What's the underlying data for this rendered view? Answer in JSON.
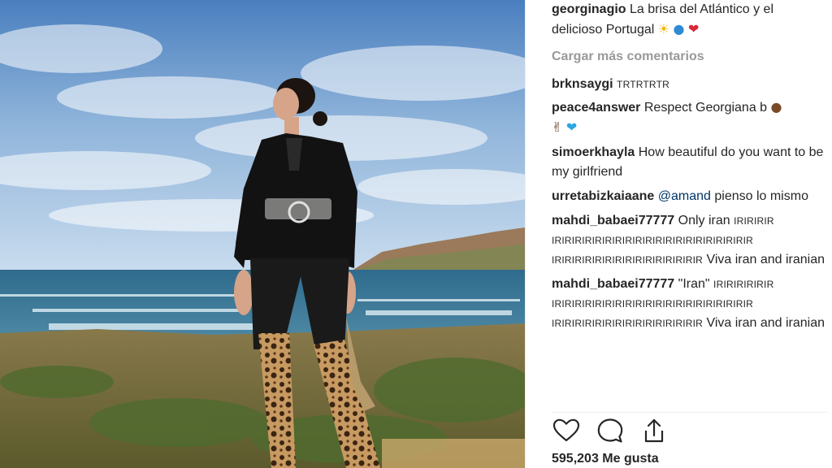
{
  "post": {
    "caption": {
      "user": "georginagio",
      "text": "La brisa del Atlántico y el delicioso Portugal"
    },
    "caption_emojis": [
      "sun-emoji",
      "globe-emoji",
      "heart-emoji"
    ],
    "load_more_label": "Cargar más comentarios",
    "comments": [
      {
        "user": "brknsaygi",
        "text": "TRTRTRTR"
      },
      {
        "user": "peace4answer",
        "text": "Respect Georgiana b"
      },
      {
        "user": "simoerkhayla",
        "text": "How beautiful do you want to be my girlfriend"
      },
      {
        "user": "urretabizkaiaane",
        "mention": "@amand",
        "text": "pienso lo mismo"
      },
      {
        "user": "mahdi_babaei77777",
        "text_a": "Only iran",
        "text_b": "IRIRIRIR",
        "text_c": "IRIRIRIRIRIRIRIRIRIRIRIRIRIRIRIRIRIRIRIR",
        "text_d": "IRIRIRIRIRIRIRIRIRIRIRIRIRIRIR",
        "text_e": "Viva iran and iranian"
      },
      {
        "user": "mahdi_babaei77777",
        "text_a": "\"Iran\"",
        "text_b": "IRIRIRIRIRIR",
        "text_c": "IRIRIRIRIRIRIRIRIRIRIRIRIRIRIRIRIRIRIRIR",
        "text_d": "IRIRIRIRIRIRIRIRIRIRIRIRIRIRIR",
        "text_e": "Viva iran and iranian"
      }
    ],
    "likes": "595,203 Me gusta"
  },
  "icons": {
    "like": "heart-outline-icon",
    "comment": "speech-bubble-icon",
    "share": "upload-share-icon"
  },
  "colors": {
    "username": "#262626",
    "mention": "#003569",
    "muted": "#999999"
  }
}
